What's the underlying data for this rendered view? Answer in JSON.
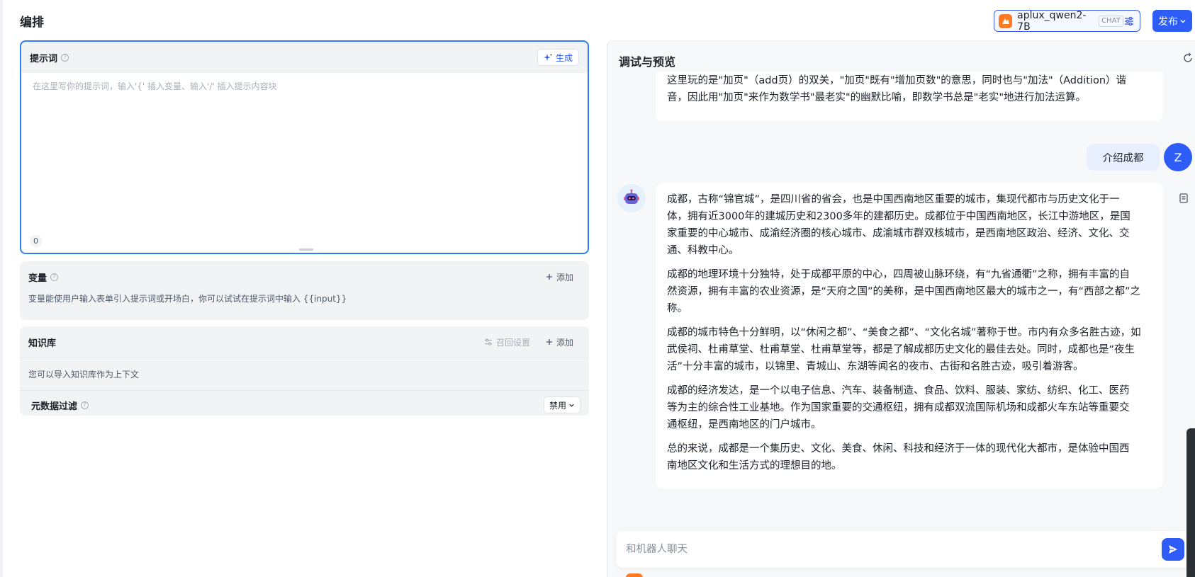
{
  "header": {
    "title": "编排",
    "model": {
      "name": "aplux_qwen2-7B",
      "tag": "CHAT"
    },
    "publish_label": "发布"
  },
  "prompt": {
    "label": "提示词",
    "generate_label": "生成",
    "placeholder": "在这里写你的提示词，输入'{' 插入变量、输入'/' 插入提示内容块",
    "char_count": "0"
  },
  "variables": {
    "label": "变量",
    "add_label": "添加",
    "description": "变量能使用户输入表单引入提示词或开场白，你可以试试在提示词中输入 {{input}}"
  },
  "knowledge": {
    "label": "知识库",
    "recall_label": "召回设置",
    "add_label": "添加",
    "description": "您可以导入知识库作为上下文",
    "meta_filter_label": "元数据过滤",
    "meta_filter_value": "禁用"
  },
  "preview": {
    "title": "调试与预览",
    "prev_bot_message": [
      "这里玩的是\"加页\"（add页）的双关，\"加页\"既有\"增加页数\"的意思，同时也与\"加法\"（Addition）谐",
      "音，因此用\"加页\"来作为数学书\"最老实\"的幽默比喻，即数学书总是\"老实\"地进行加法运算。"
    ],
    "user_message": "介绍成都",
    "user_avatar": "Z",
    "bot_paragraphs": [
      [
        "成都，古称“锦官城”，是四川省的省会，也是中国西南地区重要的城市，集现代都市与历史文化于一",
        "体，拥有近3000年的建城历史和2300多年的建都历史。成都位于中国西南地区，长江中游地区，是国",
        "家重要的中心城市、成渝经济圈的核心城市、成渝城市群双核城市，是西南地区政治、经济、文化、交",
        "通、科教中心。"
      ],
      [
        "成都的地理环境十分独特，处于成都平原的中心，四周被山脉环绕，有“九省通衢”之称，拥有丰富的自",
        "然资源，拥有丰富的农业资源，是“天府之国”的美称，是中国西南地区最大的城市之一，有“西部之都”之",
        "称。"
      ],
      [
        "成都的城市特色十分鲜明，以“休闲之都”、“美食之都”、“文化名城”著称于世。市内有众多名胜古迹，如",
        "武侯祠、杜甫草堂、杜甫草堂、杜甫草堂等，都是了解成都历史文化的最佳去处。同时，成都也是“夜生",
        "活”十分丰富的城市，以锦里、青城山、东湖等闻名的夜市、古街和名胜古迹，吸引着游客。"
      ],
      [
        "成都的经济发达，是一个以电子信息、汽车、装备制造、食品、饮料、服装、家纺、纺织、化工、医药",
        "等为主的综合性工业基地。作为国家重要的交通枢纽，拥有成都双流国际机场和成都火车东站等重要交",
        "通枢纽，是西南地区的门户城市。"
      ],
      [
        "总的来说，成都是一个集历史、文化、美食、休闲、科技和经济于一体的现代化大都市，是体验中国西",
        "南地区文化和生活方式的理想目的地。"
      ]
    ],
    "input_placeholder": "和机器人聊天"
  },
  "colors": {
    "primary": "#2d5cf6",
    "focus_border": "#2d7ef5",
    "model_brand": "#ff7a22"
  }
}
